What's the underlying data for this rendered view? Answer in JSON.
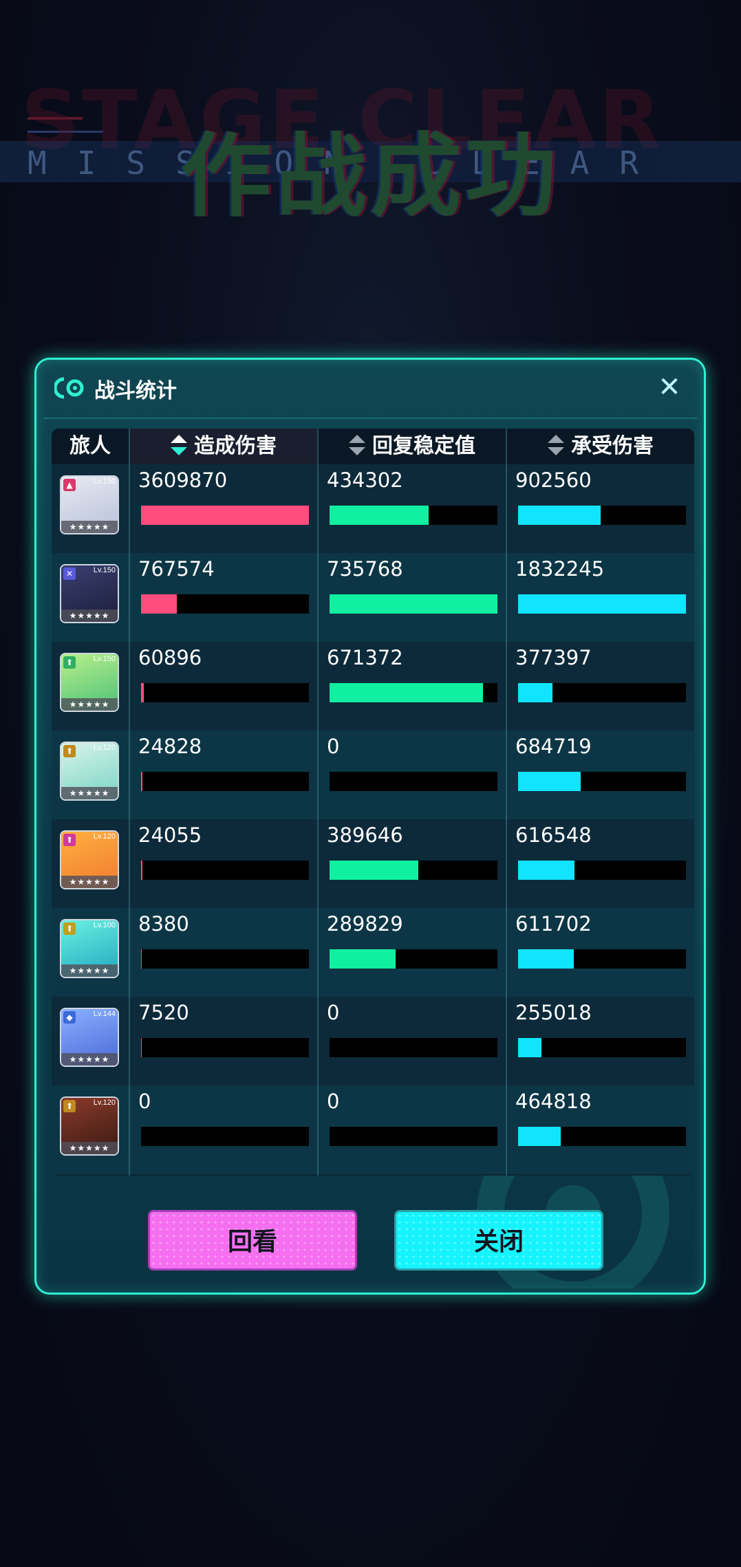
{
  "banner": {
    "title": "作战成功",
    "ghost_text": "STAGE CLEAR",
    "sub_text": "MISSION CLEAR"
  },
  "panel": {
    "title": "战斗统计",
    "close_icon": "close-icon"
  },
  "table": {
    "columns": [
      "旅人",
      "造成伤害",
      "回复稳定值",
      "承受伤害"
    ],
    "max": {
      "damage_dealt": 3609870,
      "healing": 735768,
      "damage_taken": 1832245
    },
    "rows": [
      {
        "level": "Lv.150",
        "damage_dealt": "3609870",
        "healing": "434302",
        "damage_taken": "902560",
        "role_color": "#d83a6a"
      },
      {
        "level": "Lv.150",
        "damage_dealt": "767574",
        "healing": "735768",
        "damage_taken": "1832245",
        "role_color": "#5a5ad8"
      },
      {
        "level": "Lv.150",
        "damage_dealt": "60896",
        "healing": "671372",
        "damage_taken": "377397",
        "role_color": "#30b060"
      },
      {
        "level": "Lv.120",
        "damage_dealt": "24828",
        "healing": "0",
        "damage_taken": "684719",
        "role_color": "#c08a20"
      },
      {
        "level": "Lv.120",
        "damage_dealt": "24055",
        "healing": "389646",
        "damage_taken": "616548",
        "role_color": "#d03a9a"
      },
      {
        "level": "Lv.100",
        "damage_dealt": "8380",
        "healing": "289829",
        "damage_taken": "611702",
        "role_color": "#c0a020"
      },
      {
        "level": "Lv.144",
        "damage_dealt": "7520",
        "healing": "0",
        "damage_taken": "255018",
        "role_color": "#3a6ad8"
      },
      {
        "level": "Lv.120",
        "damage_dealt": "0",
        "healing": "0",
        "damage_taken": "464818",
        "role_color": "#c08a20"
      }
    ]
  },
  "buttons": {
    "replay": "回看",
    "close": "关闭"
  },
  "colors": {
    "accent": "#2ef0d0",
    "damage": "#ff4d7d",
    "healing": "#10f0a0",
    "taken": "#10e4ff"
  }
}
